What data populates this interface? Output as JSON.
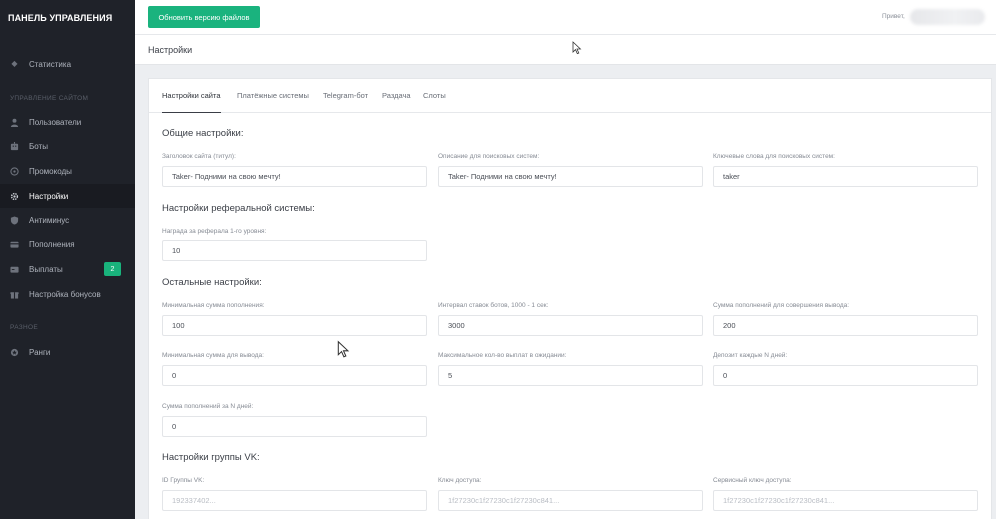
{
  "sidebar": {
    "brand": "ПАНЕЛЬ УПРАВЛЕНИЯ",
    "items_top": [
      {
        "label": "Статистика",
        "icon": "diamond-icon"
      }
    ],
    "section_site": "УПРАВЛЕНИЕ САЙТОМ",
    "items_site": [
      {
        "label": "Пользователи",
        "icon": "user-icon"
      },
      {
        "label": "Боты",
        "icon": "bot-icon"
      },
      {
        "label": "Промокоды",
        "icon": "promo-icon"
      },
      {
        "label": "Настройки",
        "icon": "settings-icon",
        "active": true
      },
      {
        "label": "Антиминус",
        "icon": "shield-icon"
      },
      {
        "label": "Пополнения",
        "icon": "card-icon"
      },
      {
        "label": "Выплаты",
        "icon": "payout-icon",
        "badge": "2"
      },
      {
        "label": "Настройка бонусов",
        "icon": "gift-icon"
      }
    ],
    "section_misc": "РАЗНОЕ",
    "items_misc": [
      {
        "label": "Ранги",
        "icon": "rank-icon"
      }
    ]
  },
  "topbar": {
    "update_button": "Обновить версию файлов",
    "greeting": "Привет,"
  },
  "page": {
    "title": "Настройки"
  },
  "tabs": [
    "Настройки сайта",
    "Платёжные системы",
    "Telegram-бот",
    "Раздача",
    "Слоты"
  ],
  "sections": {
    "general": "Общие настройки:",
    "referral": "Настройки реферальной системы:",
    "other": "Остальные настройки:",
    "vk": "Настройки группы VK:"
  },
  "fields": {
    "site_title": {
      "label": "Заголовок сайта (титул):",
      "value": "Taker- Подними на свою мечту!"
    },
    "seo_description": {
      "label": "Описание для поисковых систем:",
      "value": "Taker- Подними на свою мечту!"
    },
    "seo_keywords": {
      "label": "Ключевые слова для поисковых систем:",
      "value": "taker"
    },
    "ref_reward": {
      "label": "Награда за реферала 1-го уровня:",
      "value": "10"
    },
    "min_deposit": {
      "label": "Минимальная сумма пополнения:",
      "value": "100"
    },
    "bot_interval": {
      "label": "Интервал ставок ботов, 1000 - 1 сек:",
      "value": "3000"
    },
    "deposit_sum_for_withdraw": {
      "label": "Сумма пополнений для совершения вывода:",
      "value": "200"
    },
    "min_withdraw": {
      "label": "Минимальная сумма для вывода:",
      "value": "0"
    },
    "max_pending": {
      "label": "Максимальное кол-во выплат в ожидании:",
      "value": "5"
    },
    "deposit_every_n_days": {
      "label": "Депозит каждые N дней:",
      "value": "0"
    },
    "deposit_sum_n_days": {
      "label": "Сумма пополнений за N дней:",
      "value": "0"
    },
    "vk_group_id": {
      "label": "ID Группы VK:",
      "value": "192337402..."
    },
    "vk_access_key": {
      "label": "Ключ доступа:",
      "value": "1f27230c1f27230c1f27230c841..."
    },
    "vk_service_key": {
      "label": "Сервисный ключ доступа:",
      "value": "1f27230c1f27230c1f27230c841..."
    }
  },
  "colors": {
    "sidebar_bg": "#1f2229",
    "accent_green": "#1ab37e",
    "page_bg": "#eceef1"
  }
}
